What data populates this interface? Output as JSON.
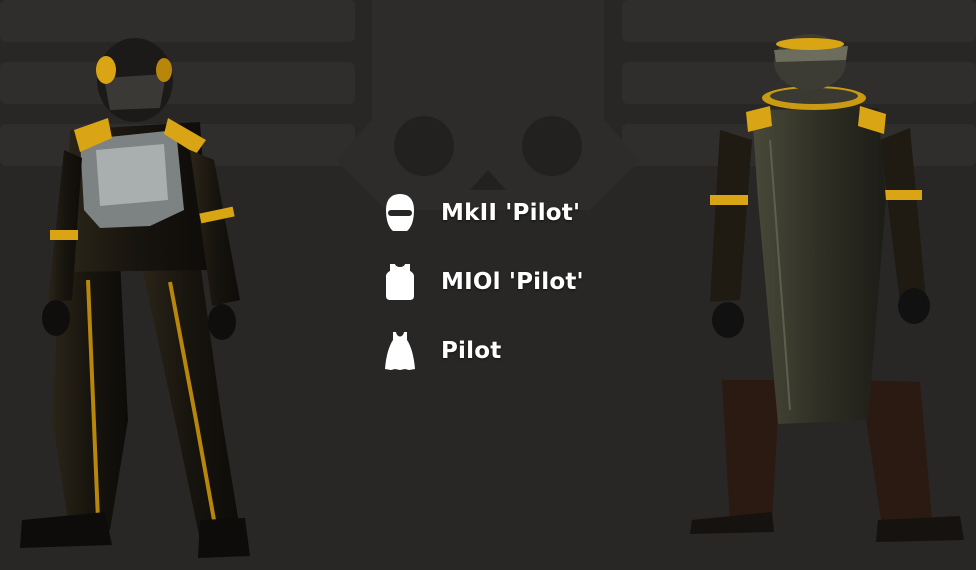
{
  "loadout": {
    "items": [
      {
        "slot": "helmet",
        "icon": "helmet-icon",
        "label": "MkII 'Pilot'"
      },
      {
        "slot": "chest",
        "icon": "chest-armor-icon",
        "label": "MIOl 'Pilot'"
      },
      {
        "slot": "undersuit",
        "icon": "undersuit-icon",
        "label": "Pilot"
      }
    ]
  },
  "colors": {
    "background": "#282725",
    "emblem": "#2f2e2c",
    "accent_gold": "#d9a514",
    "suit_black": "#16140f",
    "label": "#ffffff"
  }
}
